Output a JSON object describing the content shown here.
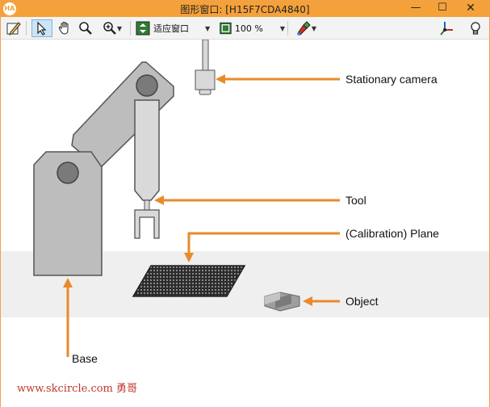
{
  "window": {
    "title": "图形窗口: [H15F7CDA4840]",
    "app_icon_text": "HA",
    "minimize_glyph": "—",
    "maximize_glyph": "☐",
    "close_glyph": "✕"
  },
  "toolbar": {
    "fit_label": "适应窗口",
    "zoom_value": "100 %"
  },
  "scene": {
    "labels": {
      "camera": "Stationary camera",
      "tool": "Tool",
      "plane": "(Calibration) Plane",
      "object": "Object",
      "base": "Base"
    },
    "colors": {
      "arrow": "#e98a2a",
      "robot": "#bdbdbd",
      "robot_outline": "#555555",
      "table": "#efefef"
    }
  },
  "watermark": "www.skcircle.com 勇哥"
}
